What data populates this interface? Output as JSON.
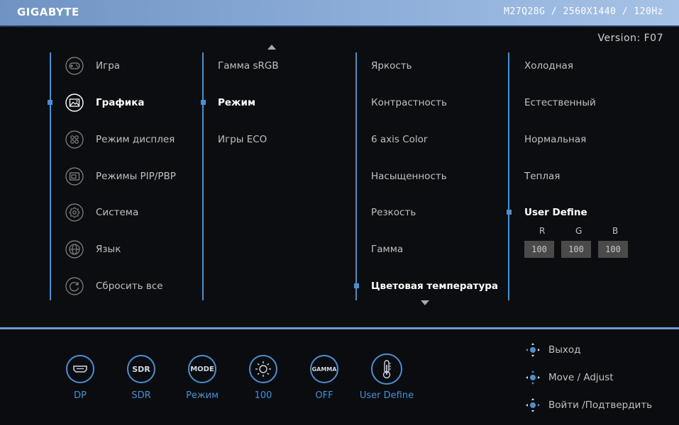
{
  "header": {
    "brand": "GIGABYTE",
    "model_info": "M27Q28G / 2560X1440 / 120Hz"
  },
  "version": "Version: F07",
  "menu": {
    "main": [
      {
        "label": "Игра",
        "icon": "gamepad-icon"
      },
      {
        "label": "Графика",
        "icon": "picture-icon",
        "selected": true
      },
      {
        "label": "Режим дисплея",
        "icon": "display-mode-icon"
      },
      {
        "label": "Режимы PIP/PBP",
        "icon": "pip-icon"
      },
      {
        "label": "Система",
        "icon": "gear-icon"
      },
      {
        "label": "Язык",
        "icon": "globe-icon"
      },
      {
        "label": "Сбросить все",
        "icon": "reset-icon"
      }
    ],
    "sub": [
      {
        "label": "Гамма sRGB"
      },
      {
        "label": "Режим",
        "selected": true
      },
      {
        "label": "Игры ECO"
      }
    ],
    "settings": [
      {
        "label": "Яркость"
      },
      {
        "label": "Контрастность"
      },
      {
        "label": "6 axis Color"
      },
      {
        "label": "Насыщенность"
      },
      {
        "label": "Резкость"
      },
      {
        "label": "Гамма"
      },
      {
        "label": "Цветовая температура",
        "selected": true
      }
    ],
    "options": [
      {
        "label": "Холодная"
      },
      {
        "label": "Естественный"
      },
      {
        "label": "Нормальная"
      },
      {
        "label": "Теплая"
      },
      {
        "label": "User Define",
        "selected": true
      }
    ],
    "rgb": {
      "labels": [
        "R",
        "G",
        "B"
      ],
      "values": [
        "100",
        "100",
        "100"
      ]
    }
  },
  "status": [
    {
      "label": "DP",
      "circle": "",
      "icon": "hdmi-port-icon"
    },
    {
      "label": "SDR",
      "circle": "SDR",
      "icon": "sdr-icon"
    },
    {
      "label": "Режим",
      "circle": "MODE",
      "icon": "mode-icon"
    },
    {
      "label": "100",
      "circle": "",
      "icon": "brightness-icon"
    },
    {
      "label": "OFF",
      "circle": "GAMMA",
      "icon": "gamma-icon"
    },
    {
      "label": "User Define",
      "circle": "",
      "icon": "thermometer-icon"
    }
  ],
  "hints": [
    {
      "label": "Выход"
    },
    {
      "label": "Move / Adjust"
    },
    {
      "label": "Войти /Подтвердить"
    }
  ],
  "colors": {
    "accent": "#4b8fd0",
    "topbar": "#8fb0da"
  }
}
